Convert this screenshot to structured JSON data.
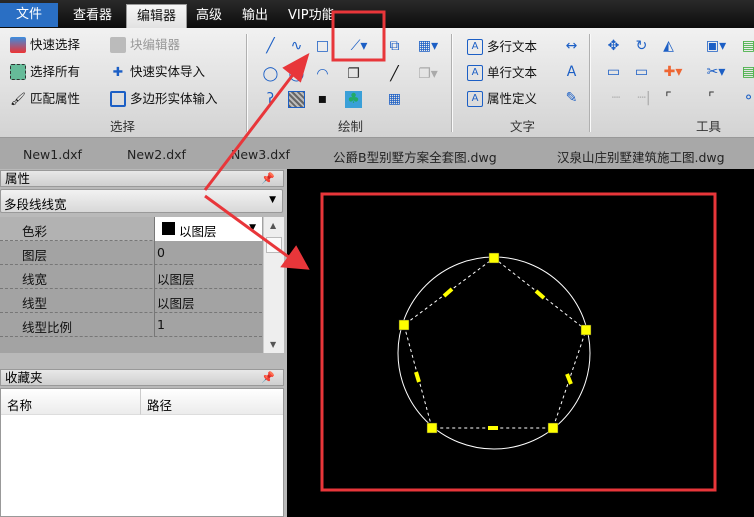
{
  "menu": {
    "tabs": [
      "文件",
      "查看器",
      "编辑器",
      "高级",
      "输出",
      "VIP功能"
    ],
    "active": "编辑器"
  },
  "ribbon": {
    "select": {
      "title": "选择",
      "items": [
        "快速选择",
        "块编辑器",
        "选择所有",
        "快速实体导入",
        "匹配属性",
        "多边形实体输入"
      ]
    },
    "draw": {
      "title": "绘制"
    },
    "text": {
      "title": "文字",
      "items": [
        "多行文本",
        "单行文本",
        "属性定义"
      ]
    },
    "tools": {
      "title": "工具"
    }
  },
  "doc_tabs": [
    "New1.dxf",
    "New2.dxf",
    "New3.dxf",
    "公爵B型别墅方案全套图.dwg",
    "汉泉山庄别墅建筑施工图.dwg"
  ],
  "properties": {
    "title": "属性",
    "selector": "多段线线宽",
    "rows": [
      {
        "key": "色彩",
        "value": "以图层"
      },
      {
        "key": "图层",
        "value": "0"
      },
      {
        "key": "线宽",
        "value": "以图层"
      },
      {
        "key": "线型",
        "value": "以图层"
      },
      {
        "key": "线型比例",
        "value": "1"
      }
    ]
  },
  "favorites": {
    "title": "收藏夹",
    "columns": [
      "名称",
      "路径"
    ]
  },
  "colors": {
    "highlight": "#e8363a",
    "grip": "#ffff00",
    "accent": "#2a6fc4"
  }
}
